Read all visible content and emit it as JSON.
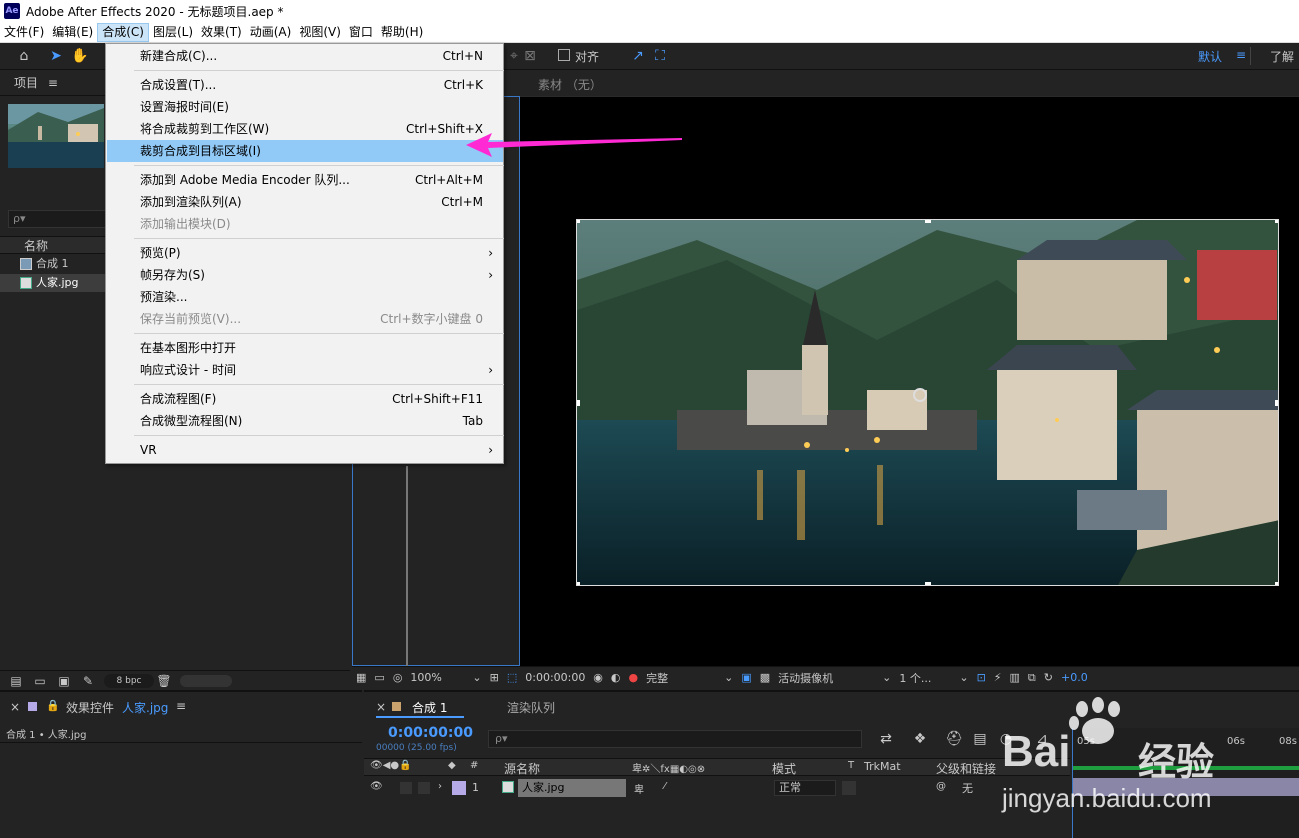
{
  "window": {
    "title": "Adobe After Effects 2020 - 无标题项目.aep *",
    "app_badge": "Ae"
  },
  "menubar": [
    "文件(F)",
    "编辑(E)",
    "合成(C)",
    "图层(L)",
    "效果(T)",
    "动画(A)",
    "视图(V)",
    "窗口",
    "帮助(H)"
  ],
  "toolbar": {
    "align_label": "对齐",
    "workspace": "默认",
    "workspace_menu": "≡",
    "learn": "了解"
  },
  "project": {
    "title": "项目",
    "menu": "≡",
    "search_placeholder": "ρ▾",
    "col_name": "名称",
    "items": [
      {
        "name": "合成 1"
      },
      {
        "name": "人家.jpg"
      }
    ],
    "bpc": "8 bpc"
  },
  "viewer": {
    "footage_tab": "素材 （无）",
    "zoom": "100%",
    "time": "0:00:00:00",
    "quality": "完整",
    "camera": "活动摄像机",
    "views": "1 个...",
    "exposure": "+0.0"
  },
  "comp_menu": {
    "items": [
      {
        "label": "新建合成(C)...",
        "shortcut": "Ctrl+N"
      },
      {
        "label": "合成设置(T)...",
        "shortcut": "Ctrl+K"
      },
      {
        "label": "设置海报时间(E)",
        "shortcut": ""
      },
      {
        "label": "将合成裁剪到工作区(W)",
        "shortcut": "Ctrl+Shift+X"
      },
      {
        "label": "裁剪合成到目标区域(I)",
        "shortcut": ""
      },
      {
        "label": "添加到 Adobe Media Encoder 队列...",
        "shortcut": "Ctrl+Alt+M"
      },
      {
        "label": "添加到渲染队列(A)",
        "shortcut": "Ctrl+M"
      },
      {
        "label": "添加输出模块(D)",
        "shortcut": ""
      },
      {
        "label": "预览(P)",
        "shortcut": ""
      },
      {
        "label": "帧另存为(S)",
        "shortcut": ""
      },
      {
        "label": "预渲染...",
        "shortcut": ""
      },
      {
        "label": "保存当前预览(V)...",
        "shortcut": "Ctrl+数字小键盘 0"
      },
      {
        "label": "在基本图形中打开",
        "shortcut": ""
      },
      {
        "label": "响应式设计 - 时间",
        "shortcut": ""
      },
      {
        "label": "合成流程图(F)",
        "shortcut": "Ctrl+Shift+F11"
      },
      {
        "label": "合成微型流程图(N)",
        "shortcut": "Tab"
      },
      {
        "label": "VR",
        "shortcut": ""
      }
    ],
    "submenu_arrow": "›"
  },
  "effects": {
    "tab": "效果控件",
    "target": "人家.jpg",
    "menu": "≡",
    "breadcrumb": "合成 1 • 人家.jpg"
  },
  "timeline": {
    "comp_tab": "合成 1",
    "render_tab": "渲染队列",
    "timecode": "0:00:00:00",
    "frames": "00000 (25.00 fps)",
    "search_placeholder": "ρ▾",
    "headers": {
      "source": "源名称",
      "mode": "模式",
      "trkmat": "TrkMat",
      "parent": "父级和链接",
      "hash": "#"
    },
    "layer": {
      "num": "1",
      "name": "人家.jpg",
      "mode": "正常",
      "parent": "无"
    },
    "ruler": [
      "05s",
      "06s",
      "08s"
    ]
  },
  "watermark": {
    "brand": "Bai",
    "brand2": "经验",
    "url": "jingyan.baidu.com"
  },
  "colors": {
    "accent": "#3a78c7",
    "highlight": "#91c9f7",
    "arrow": "#ff2ad4",
    "timecode": "#4a9bff"
  }
}
